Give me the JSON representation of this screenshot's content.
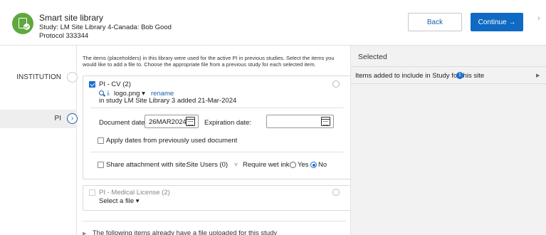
{
  "header": {
    "title": "Smart site library",
    "study_line": "Study: LM Site Library 4-Canada: Bob Good",
    "protocol_line": "Protocol 333344",
    "back_label": "Back",
    "continue_label": "Continue →",
    "close_glyph": "›"
  },
  "sidebar": {
    "items": [
      {
        "label": "INSTITUTION",
        "active": false
      },
      {
        "label": "PI",
        "active": true,
        "glyph": "›"
      }
    ]
  },
  "main": {
    "intro": "The items (placeholders) in this library were used for the active PI in previous studies. Select the items you would like to add a file to. Choose the appropriate file from a previous study for each selected item.",
    "item1": {
      "title": "PI - CV (2)",
      "file_name": "logo.png",
      "file_caret": "▾",
      "rename_label": "rename",
      "added_text": "in study LM Site Library 3 added 21-Mar-2024",
      "document_date_label": "Document date:",
      "document_date_value": "26MAR2024",
      "expiration_date_label": "Expiration date:",
      "expiration_date_value": "",
      "apply_dates_label": "Apply dates from previously used document",
      "share_label": "Share attachment with site:",
      "share_value": "Site Users (0)",
      "share_caret": "˅",
      "wet_ink_label": "Require wet ink",
      "yes_label": "Yes",
      "no_label": "No",
      "wet_ink_selected": "No"
    },
    "item2": {
      "title": "PI - Medical License (2)",
      "select_label": "Select a file",
      "select_caret": "▾"
    },
    "footer_note": "The following items already have a file uploaded for this study",
    "footer_caret": "▶"
  },
  "right_panel": {
    "header": "Selected",
    "row_label": "Items added to include in Study for this site",
    "row_count": "1",
    "row_caret": "▶"
  },
  "colors": {
    "accent": "#0e6ac2",
    "app_icon": "#5fa83d",
    "link": "#1a5fa8"
  }
}
